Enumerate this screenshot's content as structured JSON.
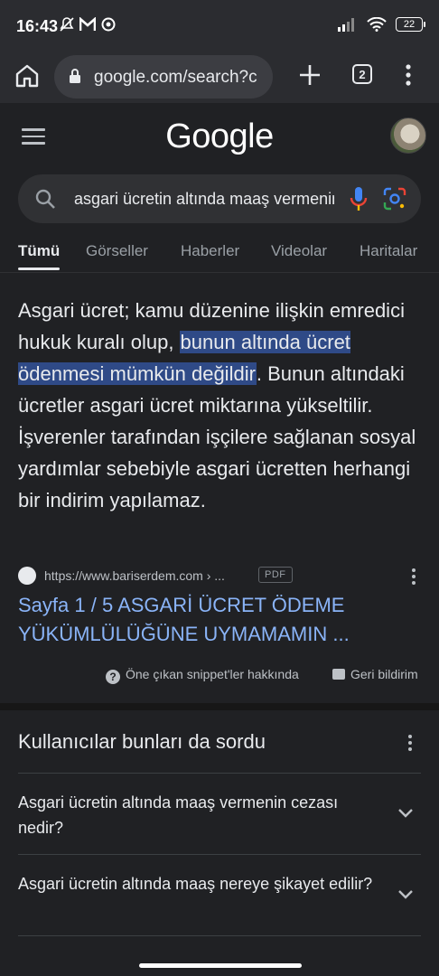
{
  "status_bar": {
    "time": "16:43",
    "battery": "22"
  },
  "browser": {
    "url": "google.com/search?c",
    "tab_count": "2"
  },
  "google": {
    "logo": "Google"
  },
  "search": {
    "query": "asgari ücretin altında maaş vermenin cezası"
  },
  "tabs": [
    "Tümü",
    "Görseller",
    "Haberler",
    "Videolar",
    "Haritalar"
  ],
  "snippet": {
    "text_before": "Asgari ücret; kamu düzenine ilişkin emredici hukuk kuralı olup, ",
    "highlight": "bunun altında ücret ödenmesi mümkün değildir",
    "text_after": ". Bunun altındaki ücretler asgari ücret miktarına yükseltilir. İşverenler tarafından işçilere sağlanan sosyal yardımlar sebebiyle asgari ücretten herhangi bir indirim yapılamaz."
  },
  "source": {
    "url": "https://www.bariserdem.com › ...",
    "badge": "PDF",
    "title": "Sayfa 1 / 5 ASGARİ ÜCRET ÖDEME YÜKÜMLÜLÜĞÜNE UYMAMAMIN ..."
  },
  "snippet_footer": {
    "about": "Öne çıkan snippet'ler hakkında",
    "feedback": "Geri bildirim"
  },
  "paa": {
    "title": "Kullanıcılar bunları da sordu",
    "questions": [
      "Asgari ücretin altında maaş vermenin cezası nedir?",
      "Asgari ücretin altında maaş nereye şikayet edilir?"
    ]
  }
}
